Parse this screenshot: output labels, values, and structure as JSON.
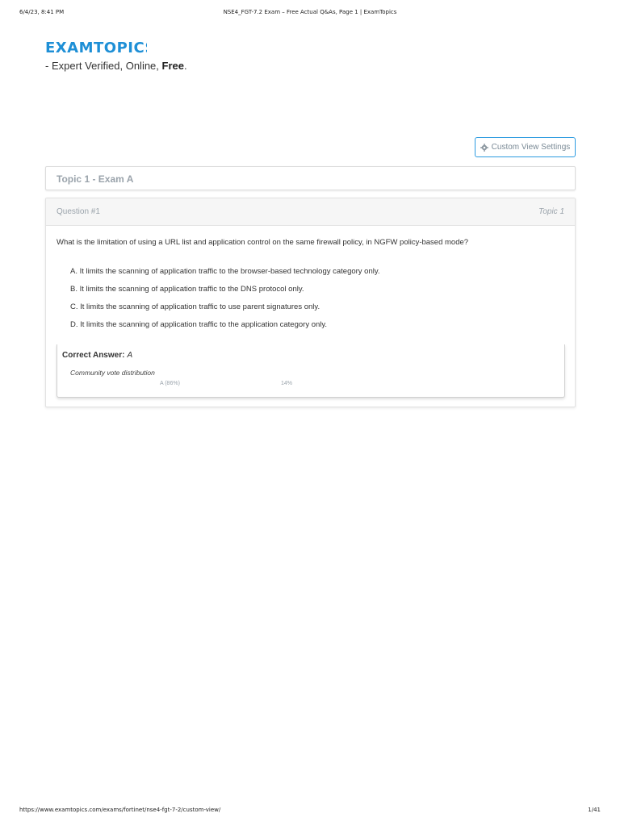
{
  "print_header": {
    "date": "6/4/23, 8:41 PM",
    "title": "NSE4_FGT-7.2 Exam – Free Actual Q&As, Page 1 | ExamTopics"
  },
  "brand": {
    "logo_text": "EXAMTOPICS",
    "logo_color": "#1e8fd6",
    "tagline_prefix": "- Expert Verified, Online, ",
    "tagline_bold": "Free",
    "tagline_suffix": "."
  },
  "settings_button": {
    "icon": "gear-icon",
    "label": "Custom View Settings"
  },
  "topic_card": {
    "title": "Topic 1 - Exam A"
  },
  "question": {
    "number": "Question #1",
    "topic": "Topic 1",
    "text": "What is the limitation of using a URL list and application control on the same firewall policy, in NGFW policy-based mode?",
    "choices": [
      "A. It limits the scanning of application traffic to the browser-based technology category only.",
      "B. It limits the scanning of application traffic to the DNS protocol only.",
      "C. It limits the scanning of application traffic to use parent signatures only.",
      "D. It limits the scanning of application traffic to the application category only."
    ],
    "correct_answer_label": "Correct Answer:",
    "correct_answer_value": "A",
    "vote_title": "Community vote distribution",
    "vote_a_label": "A (86%)",
    "vote_b_label": "14%",
    "vote_a_fraction": 0.86,
    "vote_b_fraction": 0.14
  },
  "print_footer": {
    "url": "https://www.examtopics.com/exams/fortinet/nse4-fgt-7-2/custom-view/",
    "page": "1/41"
  }
}
